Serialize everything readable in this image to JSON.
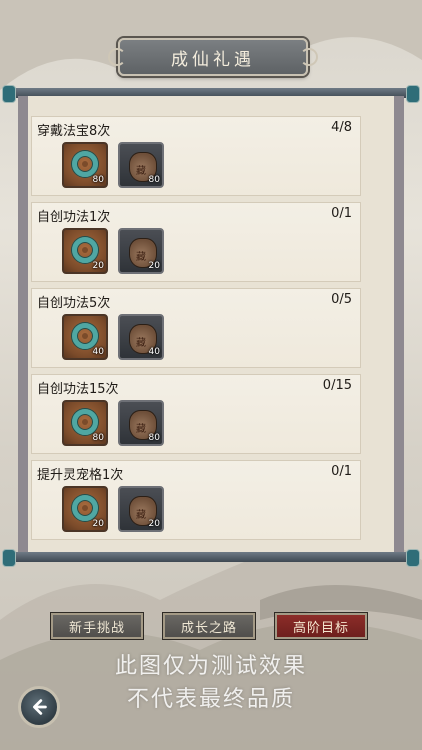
{
  "header": {
    "title": "成仙礼遇"
  },
  "tasks": [
    {
      "name": "穿戴法宝8次",
      "progress": "4/8",
      "rewards": [
        {
          "icon": "jade-ring-icon",
          "qty": "80"
        },
        {
          "icon": "treasure-bag-icon",
          "seal": "藏",
          "qty": "80"
        }
      ]
    },
    {
      "name": "自创功法1次",
      "progress": "0/1",
      "rewards": [
        {
          "icon": "jade-ring-icon",
          "qty": "20"
        },
        {
          "icon": "treasure-bag-icon",
          "seal": "藏",
          "qty": "20"
        }
      ]
    },
    {
      "name": "自创功法5次",
      "progress": "0/5",
      "rewards": [
        {
          "icon": "jade-ring-icon",
          "qty": "40"
        },
        {
          "icon": "treasure-bag-icon",
          "seal": "藏",
          "qty": "40"
        }
      ]
    },
    {
      "name": "自创功法15次",
      "progress": "0/15",
      "rewards": [
        {
          "icon": "jade-ring-icon",
          "qty": "80"
        },
        {
          "icon": "treasure-bag-icon",
          "seal": "藏",
          "qty": "80"
        }
      ]
    },
    {
      "name": "提升灵宠格1次",
      "progress": "0/1",
      "rewards": [
        {
          "icon": "jade-ring-icon",
          "qty": "20"
        },
        {
          "icon": "treasure-bag-icon",
          "seal": "藏",
          "qty": "20"
        }
      ]
    }
  ],
  "tabs": [
    {
      "label": "新手挑战",
      "active": false
    },
    {
      "label": "成长之路",
      "active": false
    },
    {
      "label": "高阶目标",
      "active": true
    }
  ],
  "watermark": {
    "line1": "此图仅为测试效果",
    "line2": "不代表最终品质"
  },
  "colors": {
    "active_tab": "#8f2e2a",
    "inactive_tab": "#5d5b57",
    "jade": "#4fa7a3"
  }
}
